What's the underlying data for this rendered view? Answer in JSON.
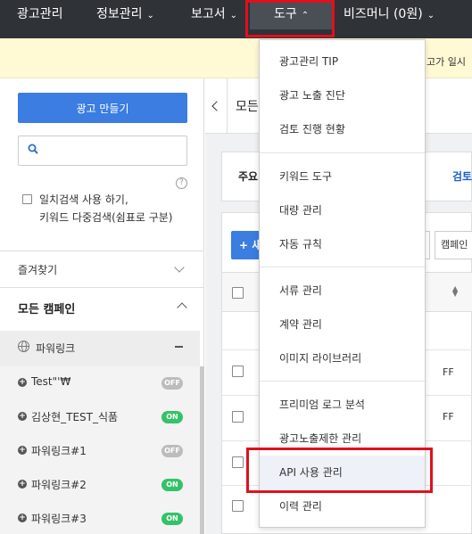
{
  "nav": {
    "items": [
      {
        "label": "광고관리",
        "chevron": false
      },
      {
        "label": "정보관리",
        "chevron": true
      },
      {
        "label": "보고서",
        "chevron": true
      },
      {
        "label": "도구",
        "chevron": true,
        "active": true
      },
      {
        "label": "비즈머니 (0원)",
        "chevron": true
      }
    ]
  },
  "notice": {
    "text": "고가 일시"
  },
  "sidebar": {
    "create_button": "광고 만들기",
    "search_placeholder": "",
    "help": "?",
    "exact_label_line1": "일치검색 사용 하기,",
    "exact_label_line2": "키워드 다중검색(쉼표로 구분)",
    "favorites": "즐겨찾기",
    "all_campaigns": "모든 캠페인",
    "powerlink": "파워링크",
    "campaigns": [
      {
        "name": "Test\"'₩",
        "status": "OFF"
      },
      {
        "name": "김상현_TEST_식품",
        "status": "ON"
      },
      {
        "name": "파워링크#1",
        "status": "OFF"
      },
      {
        "name": "파워링크#2",
        "status": "ON"
      },
      {
        "name": "파워링크#3",
        "status": "ON"
      }
    ]
  },
  "main": {
    "title": "모든",
    "summary_main": "주요",
    "summary_link": "검토",
    "add_button": "+ 새",
    "campaign_button": "캠페인",
    "row_fragments": [
      "FF",
      "FF"
    ]
  },
  "dropdown": {
    "groups": [
      [
        "광고관리 TIP",
        "광고 노출 진단",
        "검토 진행 현황"
      ],
      [
        "키워드 도구",
        "대량 관리",
        "자동 규칙"
      ],
      [
        "서류 관리",
        "계약 관리",
        "이미지 라이브러리"
      ],
      [
        "프리미엄 로그 분석",
        "광고노출제한 관리",
        "API 사용 관리",
        "이력 관리"
      ]
    ],
    "hovered": "API 사용 관리"
  },
  "colors": {
    "nav_bg": "#2f3237",
    "accent": "#3b7de0",
    "highlight": "#e0101e",
    "on": "#34c269",
    "off": "#bcbcbc"
  }
}
